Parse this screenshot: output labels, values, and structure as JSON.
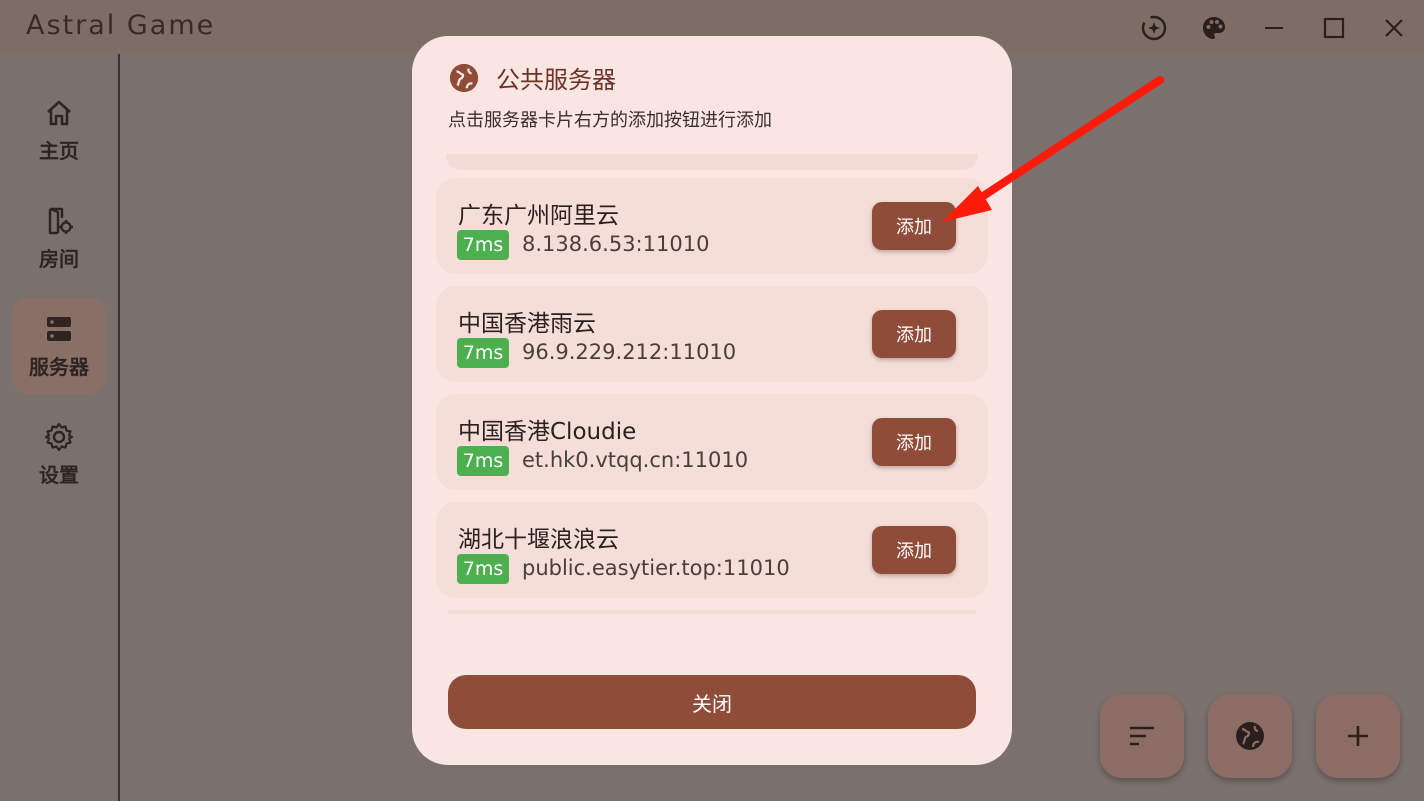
{
  "app": {
    "title": "Astral Game"
  },
  "window_controls": [
    "theme-mode-icon",
    "palette-icon",
    "minimize-icon",
    "maximize-icon",
    "close-icon"
  ],
  "sidebar": {
    "items": [
      {
        "label": "主页",
        "icon": "home-icon",
        "active": false
      },
      {
        "label": "房间",
        "icon": "room-settings-icon",
        "active": false
      },
      {
        "label": "服务器",
        "icon": "server-icon",
        "active": true
      },
      {
        "label": "设置",
        "icon": "gear-icon",
        "active": false
      }
    ]
  },
  "fabs": [
    "sort-icon",
    "globe-icon",
    "plus-icon"
  ],
  "dialog": {
    "title": "公共服务器",
    "subtitle": "点击服务器卡片右方的添加按钮进行添加",
    "servers": [
      {
        "name": "广东广州阿里云",
        "latency": "7ms",
        "address": "8.138.6.53:11010",
        "add_label": "添加"
      },
      {
        "name": "中国香港雨云",
        "latency": "7ms",
        "address": "96.9.229.212:11010",
        "add_label": "添加"
      },
      {
        "name": "中国香港Cloudie",
        "latency": "7ms",
        "address": "et.hk0.vtqq.cn:11010",
        "add_label": "添加"
      },
      {
        "name": "湖北十堰浪浪云",
        "latency": "7ms",
        "address": "public.easytier.top:11010",
        "add_label": "添加"
      }
    ],
    "close_label": "关闭"
  },
  "colors": {
    "accent": "#8f4c39",
    "latency_badge": "#4caf50",
    "annotation_arrow": "#ff1a0a"
  }
}
